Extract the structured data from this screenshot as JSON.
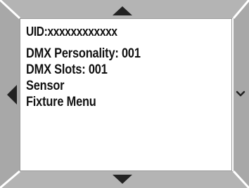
{
  "screen": {
    "uid_label": "UID:xxxxxxxxxxxx",
    "menu_items": [
      {
        "label": "DMX Personality: 001"
      },
      {
        "label": "DMX Slots: 001"
      },
      {
        "label": "Sensor"
      },
      {
        "label": "Fixture Menu"
      }
    ]
  },
  "icons": {
    "up": "triangle-up",
    "down": "triangle-down",
    "left": "triangle-left",
    "right": "chevron-right"
  },
  "colors": {
    "frame": "#b4b4b4",
    "frame_edge": "#8c8c8c",
    "arrows": "#222222",
    "text": "#111111",
    "screen": "#ffffff"
  }
}
